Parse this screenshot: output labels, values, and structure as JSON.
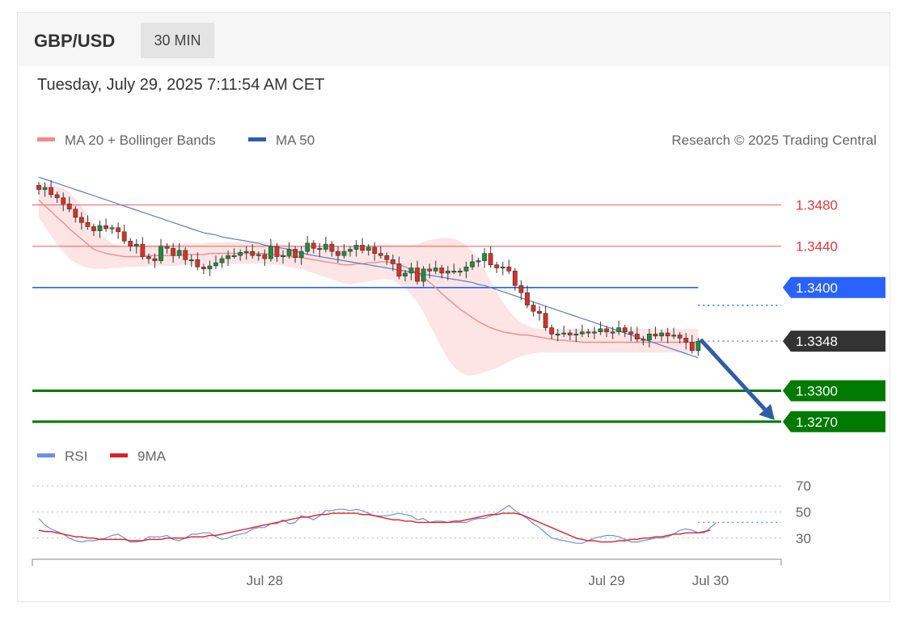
{
  "header": {
    "symbol": "GBP/USD",
    "timeframe": "30 MIN",
    "datetime": "Tuesday, July 29, 2025 7:11:54 AM CET"
  },
  "legend": {
    "ma20_label": "MA 20 + Bollinger Bands",
    "ma20_color": "#f28b8b",
    "ma50_label": "MA 50",
    "ma50_color": "#2f5ea8",
    "copyright": "Research © 2025 Trading Central"
  },
  "rsi_legend": {
    "rsi_label": "RSI",
    "rsi_color": "#6b8fe6",
    "ma9_label": "9MA",
    "ma9_color": "#e02020"
  },
  "chart_data": {
    "type": "candlestick",
    "ylim": [
      1.3262,
      1.3522
    ],
    "levels": [
      {
        "value": 1.348,
        "label": "1.3480",
        "kind": "resistance",
        "color": "#e53935"
      },
      {
        "value": 1.344,
        "label": "1.3440",
        "kind": "resistance",
        "color": "#e53935"
      },
      {
        "value": 1.34,
        "label": "1.3400",
        "kind": "pivot",
        "color": "#2962ff"
      },
      {
        "value": 1.3348,
        "label": "1.3348",
        "kind": "last-price",
        "color": "#333333"
      },
      {
        "value": 1.33,
        "label": "1.3300",
        "kind": "support",
        "color": "#007a00"
      },
      {
        "value": 1.327,
        "label": "1.3270",
        "kind": "support",
        "color": "#007a00"
      }
    ],
    "x_ticks": [
      "Jul 28",
      "Jul 29",
      "Jul 30"
    ],
    "closes": [
      1.3495,
      1.3497,
      1.349,
      1.3487,
      1.3481,
      1.3476,
      1.3468,
      1.3463,
      1.3459,
      1.3455,
      1.346,
      1.3457,
      1.3458,
      1.3454,
      1.3445,
      1.344,
      1.3442,
      1.343,
      1.3428,
      1.3426,
      1.344,
      1.3438,
      1.3431,
      1.3436,
      1.3427,
      1.3427,
      1.342,
      1.3418,
      1.3421,
      1.3424,
      1.3428,
      1.3431,
      1.3431,
      1.3434,
      1.3435,
      1.3431,
      1.3432,
      1.3428,
      1.344,
      1.343,
      1.3431,
      1.3437,
      1.3429,
      1.3435,
      1.3443,
      1.3438,
      1.3437,
      1.3442,
      1.3435,
      1.3431,
      1.3435,
      1.3437,
      1.3441,
      1.3436,
      1.3439,
      1.3433,
      1.3431,
      1.3427,
      1.3423,
      1.3411,
      1.3414,
      1.3419,
      1.3406,
      1.3418,
      1.3416,
      1.3419,
      1.3414,
      1.3416,
      1.3416,
      1.3416,
      1.342,
      1.3425,
      1.3426,
      1.3433,
      1.3422,
      1.3419,
      1.342,
      1.3416,
      1.3402,
      1.3395,
      1.3383,
      1.3377,
      1.3375,
      1.3361,
      1.3355,
      1.3355,
      1.3356,
      1.3354,
      1.3355,
      1.3357,
      1.3357,
      1.3357,
      1.336,
      1.3357,
      1.3357,
      1.3361,
      1.3357,
      1.3355,
      1.335,
      1.3349,
      1.3355,
      1.3353,
      1.3356,
      1.3353,
      1.3354,
      1.3351,
      1.3347,
      1.3339,
      1.3348
    ],
    "ma20": [
      1.3485,
      1.3479,
      1.3474,
      1.3468,
      1.3463,
      1.3457,
      1.3452,
      1.3447,
      1.3442,
      1.3437,
      1.3435,
      1.3433,
      1.3432,
      1.3431,
      1.343,
      1.343,
      1.343,
      1.343,
      1.3431,
      1.3431,
      1.3431,
      1.3431,
      1.3431,
      1.3431,
      1.3432,
      1.3432,
      1.3432,
      1.3432,
      1.3433,
      1.3433,
      1.3433,
      1.3433,
      1.3433,
      1.3433,
      1.3433,
      1.3433,
      1.3433,
      1.3433,
      1.3432,
      1.3432,
      1.3431,
      1.343,
      1.343,
      1.3429,
      1.3428,
      1.3427,
      1.3426,
      1.3425,
      1.3424,
      1.3423,
      1.3422,
      1.3422,
      1.3423,
      1.3423,
      1.3424,
      1.3424,
      1.3425,
      1.3425,
      1.3424,
      1.3422,
      1.342,
      1.3417,
      1.3414,
      1.341,
      1.3405,
      1.34,
      1.3394,
      1.3389,
      1.3384,
      1.3379,
      1.3375,
      1.3371,
      1.3367,
      1.3364,
      1.3361,
      1.3359,
      1.3357,
      1.3356,
      1.3355,
      1.3354,
      1.3354,
      1.3353,
      1.3352,
      1.3351,
      1.335,
      1.3349,
      1.3349,
      1.3348,
      1.3348,
      1.3347,
      1.3347,
      1.3347,
      1.3347,
      1.3347,
      1.3347,
      1.3347,
      1.3347,
      1.3347,
      1.3347,
      1.3347,
      1.3347,
      1.3347,
      1.3347,
      1.3347,
      1.3347,
      1.3347,
      1.3347,
      1.3347,
      1.3347
    ],
    "band_upper": [
      1.3502,
      1.3501,
      1.35,
      1.3498,
      1.3496,
      1.3492,
      1.3486,
      1.3479,
      1.347,
      1.346,
      1.3452,
      1.3447,
      1.3443,
      1.3441,
      1.344,
      1.344,
      1.344,
      1.344,
      1.3441,
      1.3441,
      1.3442,
      1.3442,
      1.3442,
      1.3442,
      1.3443,
      1.3443,
      1.3443,
      1.3443,
      1.3444,
      1.3444,
      1.3444,
      1.3444,
      1.3444,
      1.3444,
      1.3444,
      1.3444,
      1.3444,
      1.3444,
      1.3443,
      1.3443,
      1.3442,
      1.3441,
      1.3441,
      1.344,
      1.344,
      1.344,
      1.344,
      1.344,
      1.344,
      1.344,
      1.344,
      1.344,
      1.344,
      1.344,
      1.3441,
      1.3441,
      1.3442,
      1.3442,
      1.3441,
      1.3441,
      1.3441,
      1.3441,
      1.3442,
      1.3444,
      1.3446,
      1.3447,
      1.3448,
      1.3448,
      1.3447,
      1.3445,
      1.3441,
      1.3435,
      1.3427,
      1.3417,
      1.3406,
      1.3396,
      1.3386,
      1.3378,
      1.3371,
      1.3366,
      1.3363,
      1.3361,
      1.336,
      1.336,
      1.336,
      1.336,
      1.336,
      1.336,
      1.336,
      1.336,
      1.336,
      1.336,
      1.336,
      1.336,
      1.336,
      1.336,
      1.336,
      1.336,
      1.336,
      1.336,
      1.336,
      1.336,
      1.336,
      1.336,
      1.336,
      1.336,
      1.336,
      1.336,
      1.336
    ],
    "band_lower": [
      1.3468,
      1.3459,
      1.345,
      1.3442,
      1.3435,
      1.3428,
      1.3424,
      1.3421,
      1.3419,
      1.3418,
      1.3418,
      1.3418,
      1.3419,
      1.3419,
      1.342,
      1.342,
      1.342,
      1.342,
      1.3421,
      1.3421,
      1.3421,
      1.3421,
      1.3421,
      1.3421,
      1.3422,
      1.3422,
      1.3422,
      1.3422,
      1.3423,
      1.3423,
      1.3423,
      1.3423,
      1.3423,
      1.3423,
      1.3423,
      1.3423,
      1.3423,
      1.3423,
      1.3422,
      1.3422,
      1.3421,
      1.342,
      1.3419,
      1.3418,
      1.3416,
      1.3414,
      1.3412,
      1.341,
      1.3408,
      1.3406,
      1.3404,
      1.3403,
      1.3404,
      1.3405,
      1.3406,
      1.3407,
      1.3408,
      1.3408,
      1.3407,
      1.3403,
      1.3399,
      1.3393,
      1.3386,
      1.3376,
      1.3364,
      1.3353,
      1.3341,
      1.3331,
      1.3323,
      1.3318,
      1.3315,
      1.3315,
      1.3316,
      1.3318,
      1.332,
      1.3322,
      1.3325,
      1.3328,
      1.3331,
      1.3333,
      1.3335,
      1.3336,
      1.3337,
      1.3337,
      1.3337,
      1.3337,
      1.3337,
      1.3337,
      1.3337,
      1.3337,
      1.3337,
      1.3337,
      1.3337,
      1.3337,
      1.3337,
      1.3337,
      1.3337,
      1.3337,
      1.3337,
      1.3337,
      1.3337,
      1.3337,
      1.3337,
      1.3337,
      1.3337,
      1.3337,
      1.3337,
      1.3337,
      1.3337
    ],
    "ma50": [
      1.3507,
      1.3505,
      1.3503,
      1.3501,
      1.3499,
      1.3497,
      1.3495,
      1.3493,
      1.3491,
      1.3489,
      1.3487,
      1.3485,
      1.3483,
      1.3481,
      1.3479,
      1.3477,
      1.3475,
      1.3473,
      1.3471,
      1.3469,
      1.3467,
      1.3465,
      1.3463,
      1.3461,
      1.3459,
      1.3457,
      1.3455,
      1.3453,
      1.3452,
      1.3451,
      1.3449,
      1.3448,
      1.3447,
      1.3446,
      1.3445,
      1.3444,
      1.3443,
      1.3441,
      1.344,
      1.3439,
      1.3438,
      1.3437,
      1.3435,
      1.3434,
      1.3432,
      1.3431,
      1.343,
      1.3429,
      1.3428,
      1.3427,
      1.3426,
      1.3425,
      1.3424,
      1.3423,
      1.3422,
      1.3421,
      1.342,
      1.3419,
      1.3418,
      1.3417,
      1.3416,
      1.3415,
      1.3414,
      1.3413,
      1.3412,
      1.3411,
      1.341,
      1.3409,
      1.3408,
      1.3407,
      1.3406,
      1.3405,
      1.3403,
      1.3402,
      1.34,
      1.3398,
      1.3396,
      1.3394,
      1.3392,
      1.339,
      1.3388,
      1.3386,
      1.3384,
      1.3382,
      1.338,
      1.3378,
      1.3376,
      1.3374,
      1.3372,
      1.337,
      1.3368,
      1.3366,
      1.3364,
      1.3362,
      1.336,
      1.3358,
      1.3356,
      1.3354,
      1.3352,
      1.335,
      1.3348,
      1.3346,
      1.3344,
      1.3342,
      1.334,
      1.3338,
      1.3336,
      1.3334,
      1.3332
    ],
    "forecast_target": 1.327,
    "rsi": {
      "ylim": [
        15,
        80
      ],
      "levels": [
        70,
        50,
        30
      ],
      "rsi": [
        45,
        40,
        37,
        35,
        33,
        30,
        28,
        27,
        28,
        28,
        29,
        30,
        32,
        33,
        30,
        27,
        27,
        28,
        31,
        31,
        31,
        32,
        29,
        28,
        30,
        33,
        33,
        34,
        34,
        31,
        29,
        30,
        32,
        33,
        34,
        37,
        38,
        38,
        41,
        41,
        44,
        41,
        42,
        47,
        46,
        44,
        47,
        51,
        51,
        52,
        52,
        51,
        52,
        51,
        49,
        47,
        47,
        47,
        48,
        49,
        48,
        47,
        44,
        45,
        42,
        43,
        43,
        42,
        42,
        42,
        42,
        44,
        45,
        45,
        47,
        49,
        52,
        55,
        51,
        48,
        45,
        41,
        38,
        34,
        30,
        29,
        28,
        27,
        26,
        26,
        28,
        30,
        31,
        32,
        32,
        31,
        29,
        27,
        27,
        28,
        29,
        30,
        30,
        31,
        33,
        36,
        37,
        36,
        34,
        34,
        38,
        42
      ],
      "ma9": [
        36,
        35,
        35,
        34,
        33,
        32,
        31,
        31,
        30,
        30,
        29,
        29,
        29,
        29,
        29,
        28,
        28,
        28,
        29,
        29,
        29,
        30,
        30,
        30,
        30,
        31,
        31,
        31,
        32,
        32,
        33,
        34,
        35,
        36,
        37,
        38,
        39,
        40,
        41,
        42,
        43,
        44,
        45,
        46,
        46,
        47,
        48,
        48,
        49,
        49,
        49,
        49,
        49,
        48,
        48,
        47,
        46,
        45,
        44,
        44,
        43,
        43,
        42,
        42,
        42,
        42,
        42,
        42,
        43,
        43,
        44,
        45,
        46,
        47,
        48,
        48,
        49,
        49,
        49,
        48,
        46,
        44,
        42,
        40,
        38,
        36,
        34,
        32,
        30,
        29,
        28,
        28,
        27,
        27,
        27,
        28,
        28,
        29,
        29,
        30,
        30,
        31,
        31,
        32,
        33,
        33,
        34,
        34,
        34,
        35,
        36
      ]
    }
  }
}
